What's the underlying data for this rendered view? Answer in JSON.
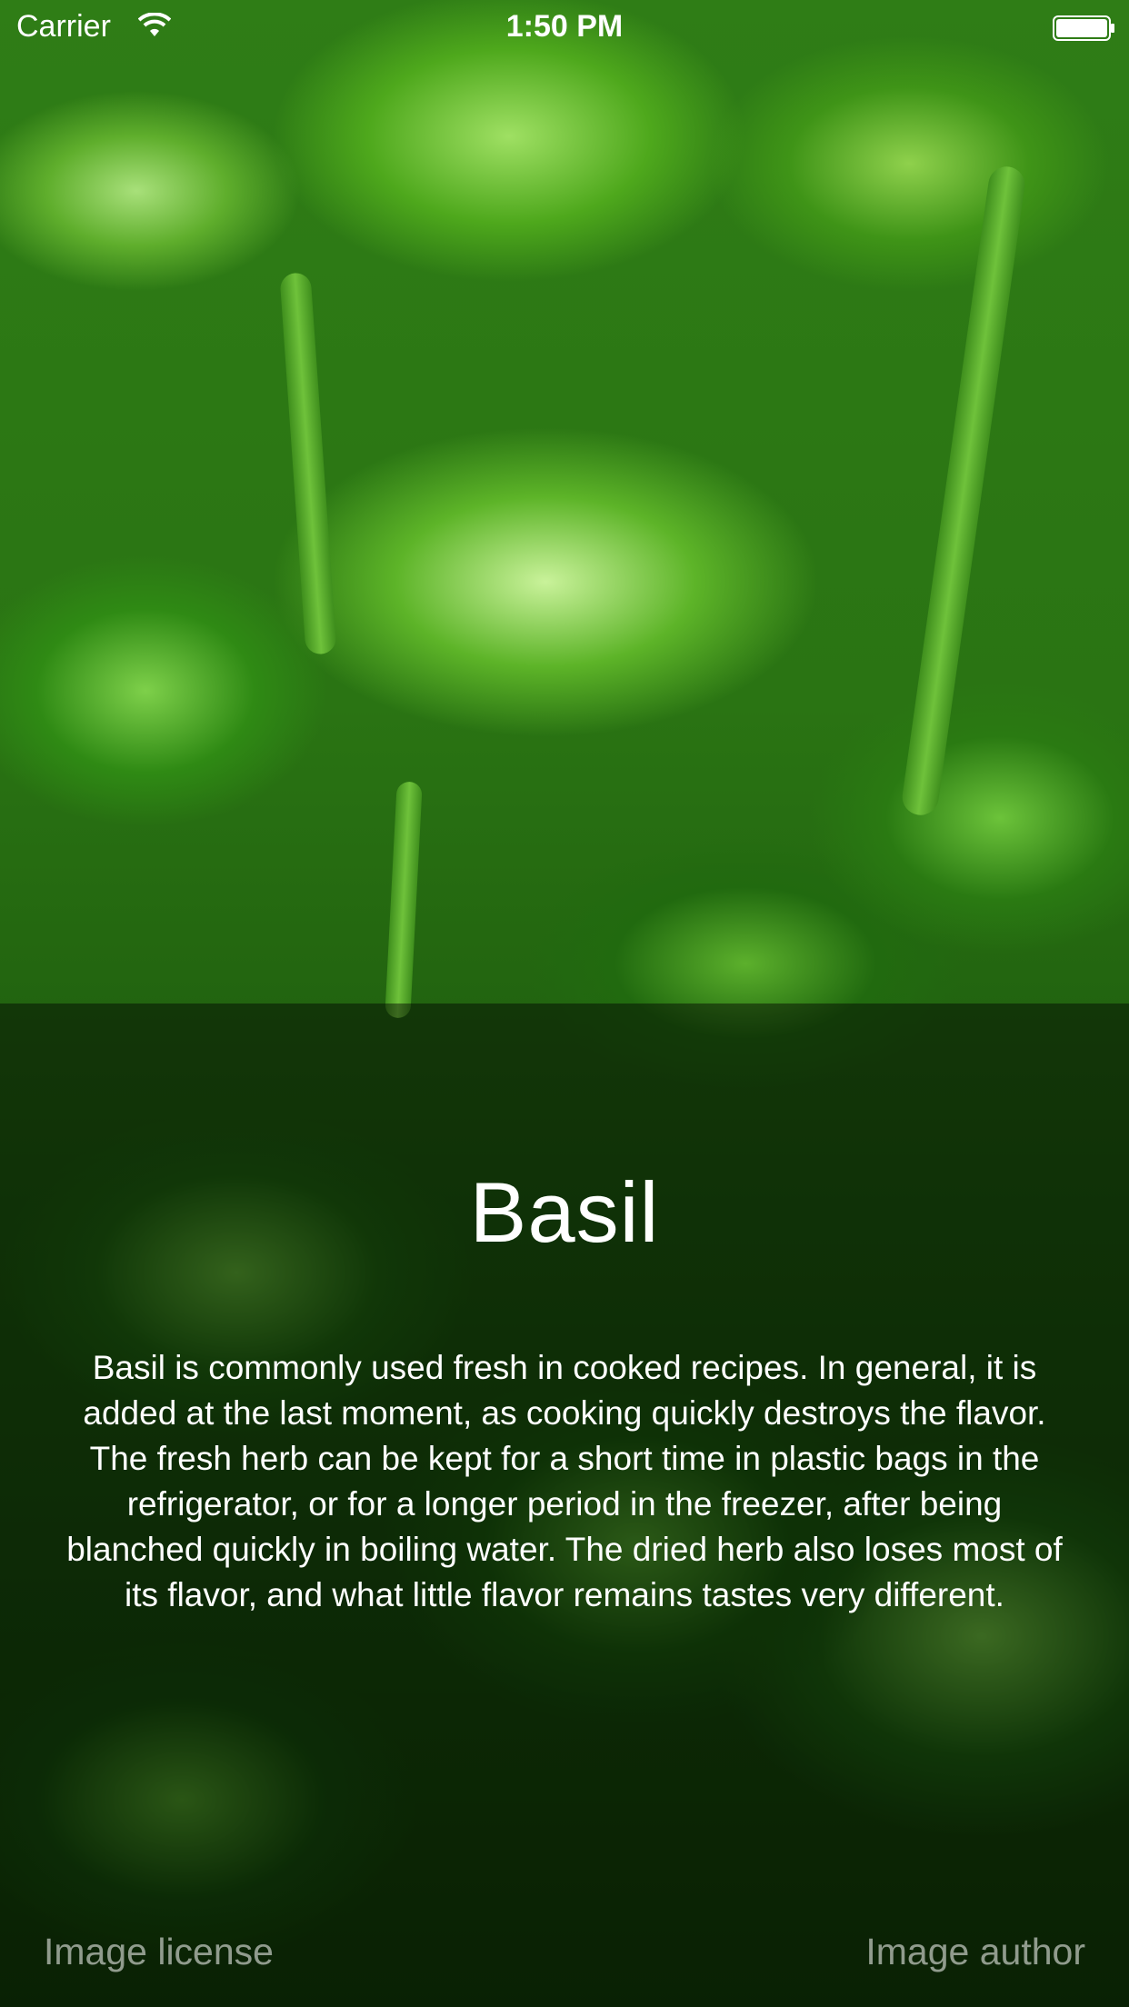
{
  "status_bar": {
    "carrier": "Carrier",
    "time": "1:50 PM",
    "wifi_icon": "wifi-icon",
    "battery_icon": "battery-icon"
  },
  "herb": {
    "name": "Basil",
    "description": "Basil is commonly used fresh in cooked recipes. In general, it is added at the last moment, as cooking quickly destroys the flavor. The fresh herb can be kept for a short time in plastic bags in the refrigerator, or for a longer period in the freezer, after being blanched quickly in boiling water. The dried herb also loses most of its flavor, and what little flavor remains tastes very different."
  },
  "footer": {
    "license_label": "Image license",
    "author_label": "Image author"
  },
  "colors": {
    "overlay": "#000000",
    "text": "#ffffff",
    "link_text": "#ffffff8c",
    "leaf_green": "#5db428"
  }
}
